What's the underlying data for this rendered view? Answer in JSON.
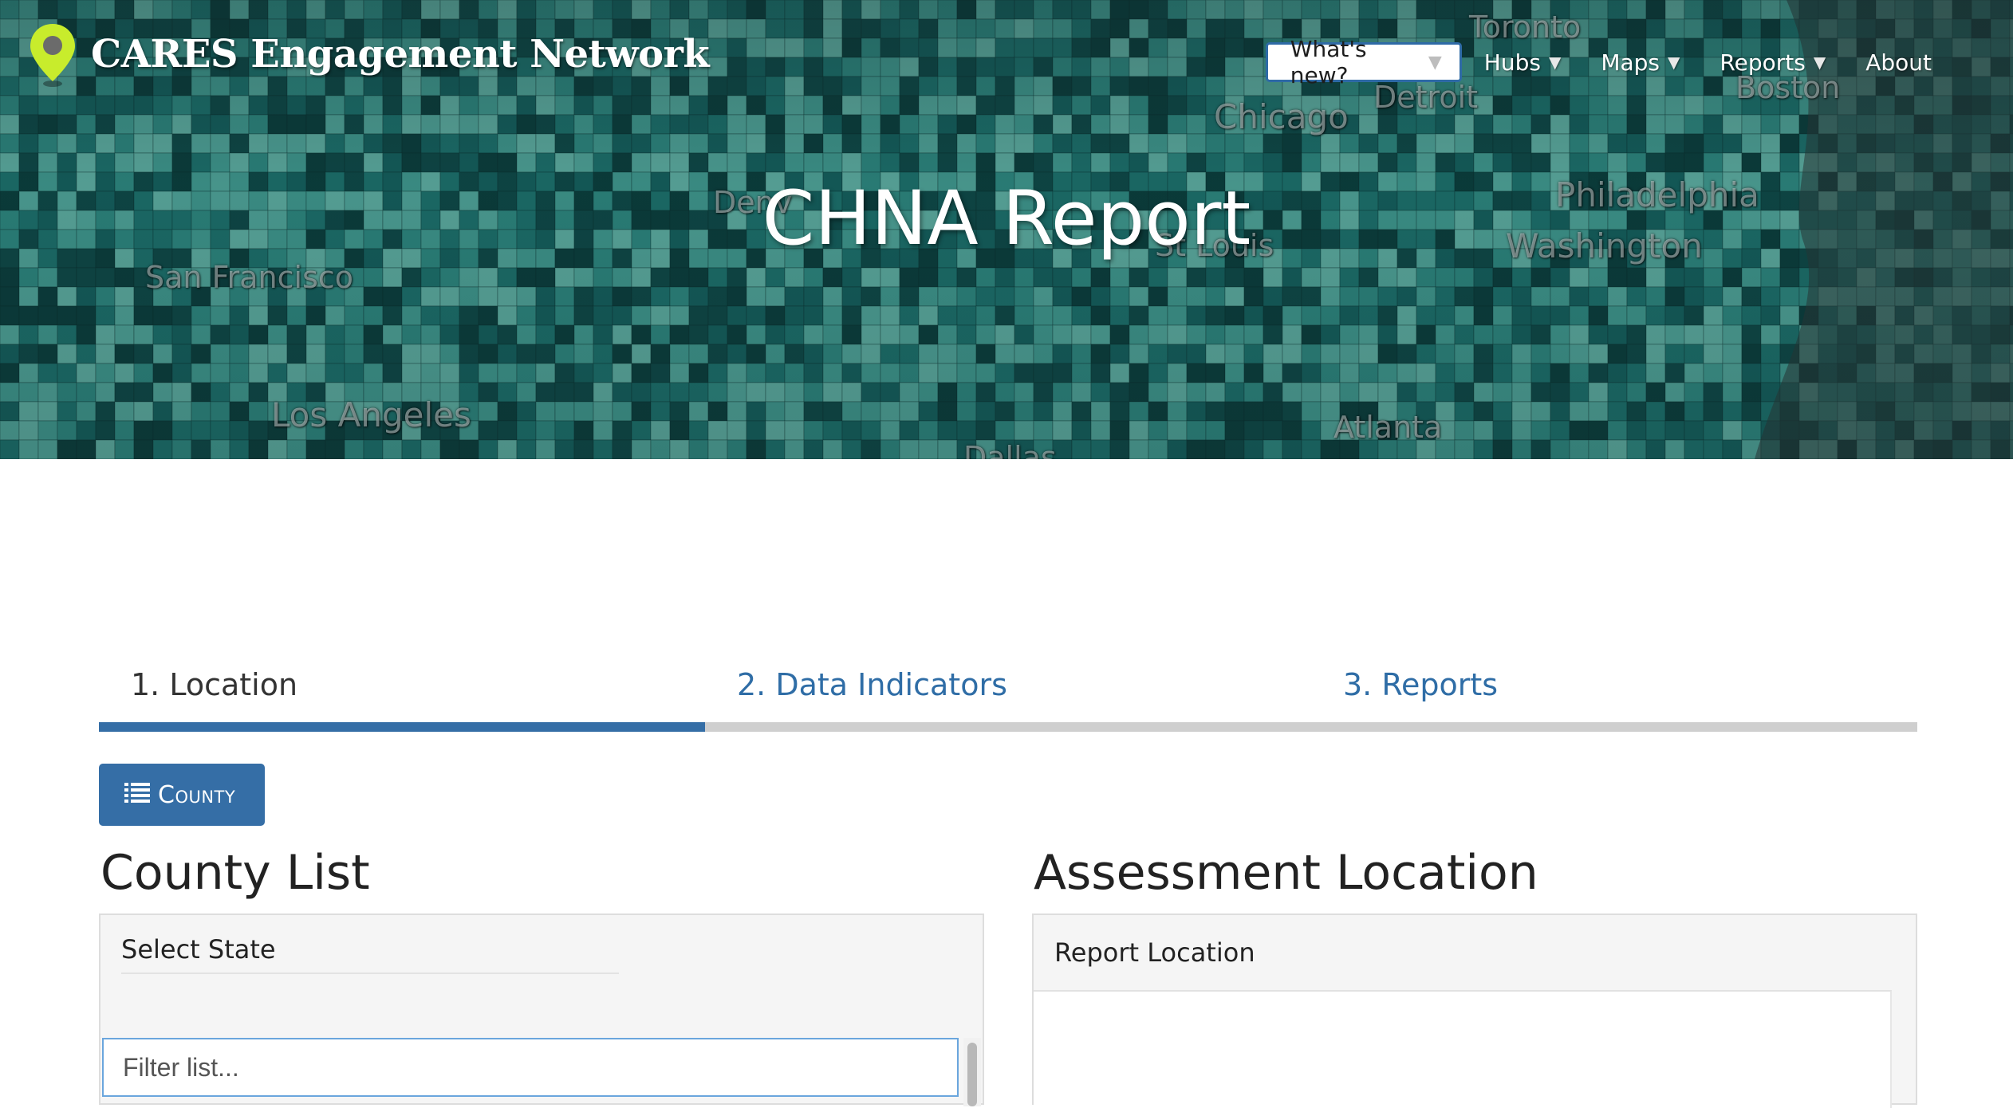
{
  "header": {
    "brand": "CARES Engagement Network",
    "nav": {
      "whats_new": "What's new?",
      "hubs": "Hubs",
      "maps": "Maps",
      "reports": "Reports",
      "about": "About"
    },
    "title": "CHNA Report"
  },
  "map_labels": {
    "toronto": "Toronto",
    "detroit": "Detroit",
    "chicago": "Chicago",
    "boston": "Boston",
    "denver": "Denv",
    "st_louis": "St Louis",
    "philadelphia": "Philadelphia",
    "washington": "Washington",
    "san_francisco": "San Francisco",
    "los_angeles": "Los Angeles",
    "atlanta": "Atlanta",
    "dallas": "Dallas"
  },
  "steps": [
    {
      "label": "1. Location",
      "active": true
    },
    {
      "label": "2. Data Indicators",
      "active": false
    },
    {
      "label": "3. Reports",
      "active": false
    }
  ],
  "county_button": {
    "label": "County",
    "icon": "list-icon"
  },
  "county_list": {
    "title": "County List",
    "select_state_label": "Select State",
    "filter_placeholder": "Filter list..."
  },
  "assessment": {
    "title": "Assessment Location",
    "report_location_label": "Report Location"
  },
  "colors": {
    "primary": "#356ea6",
    "link": "#2f6da6",
    "brand_pin": "#c8ec2c",
    "map_base": "#0f4d4c"
  }
}
